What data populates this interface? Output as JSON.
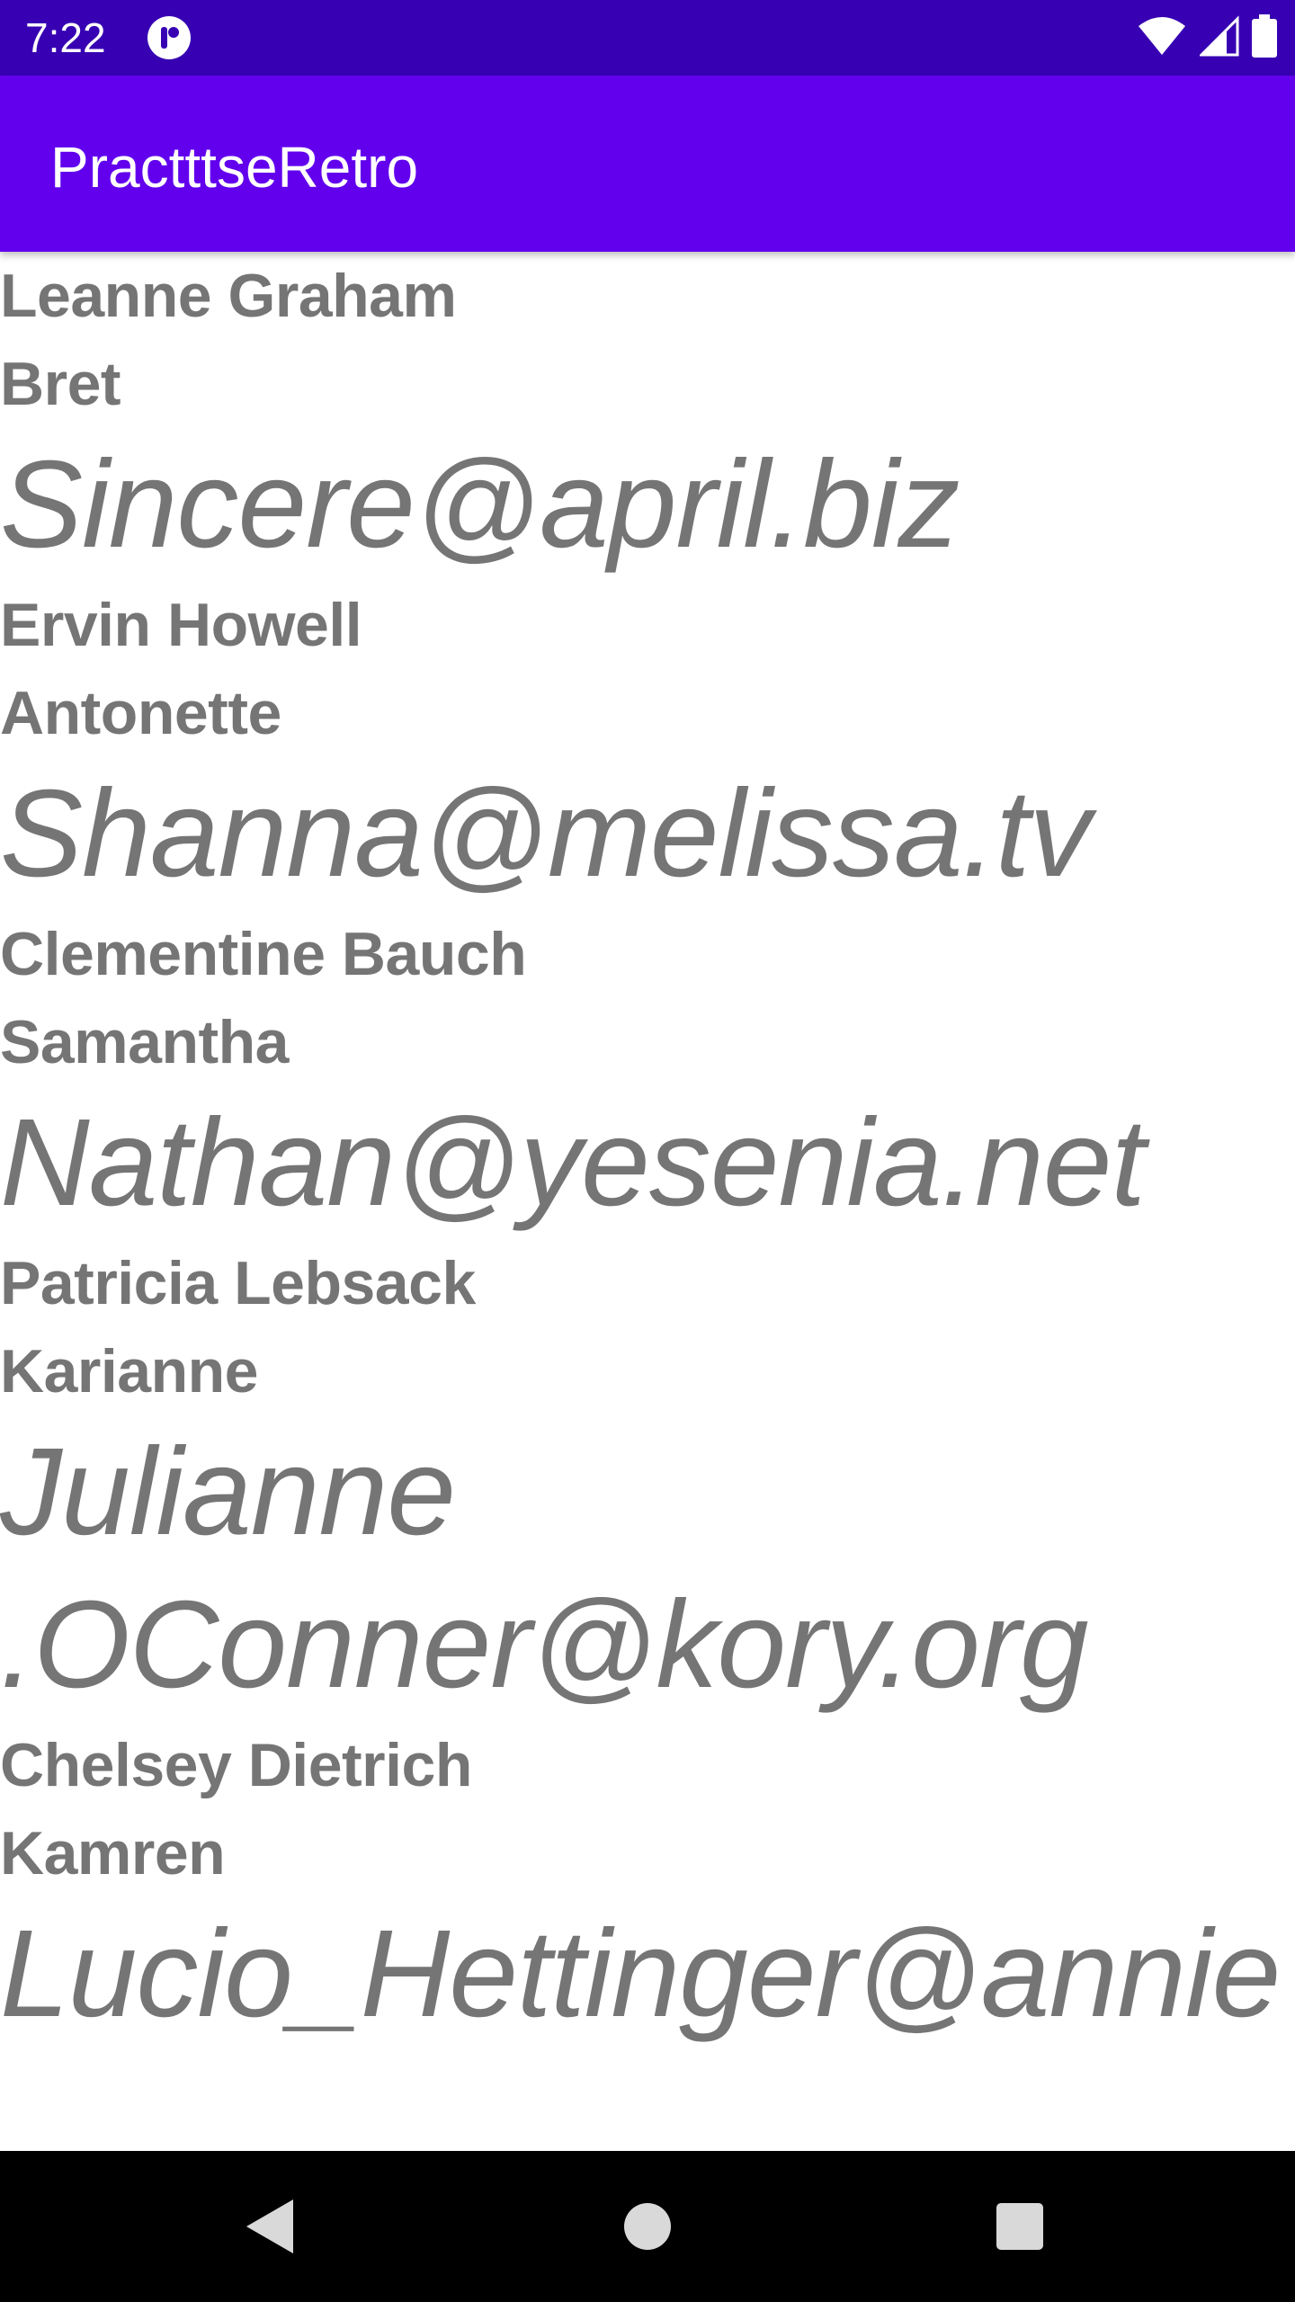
{
  "status_bar": {
    "time": "7:22",
    "app_icon": "app-notification-icon",
    "icons": [
      "wifi-icon",
      "cell-signal-icon",
      "battery-icon"
    ],
    "color": "#3700b3"
  },
  "app_bar": {
    "title": "PractttseRetro",
    "color": "#6200ee"
  },
  "users": [
    {
      "name": "Leanne Graham",
      "username": "Bret",
      "email": "Sincere@april.biz"
    },
    {
      "name": "Ervin Howell",
      "username": "Antonette",
      "email": "Shanna@melissa.tv"
    },
    {
      "name": "Clementine Bauch",
      "username": "Samantha",
      "email": "Nathan@yesenia.net"
    },
    {
      "name": "Patricia Lebsack",
      "username": "Karianne",
      "email": "Julianne.OConner@kory.org"
    },
    {
      "name": "Chelsey Dietrich",
      "username": "Kamren",
      "email": "Lucio_Hettinger@annie"
    }
  ],
  "nav_bar": {
    "buttons": [
      "back-icon",
      "home-icon",
      "recents-icon"
    ]
  },
  "colors": {
    "text": "#757575",
    "background": "#ffffff"
  }
}
